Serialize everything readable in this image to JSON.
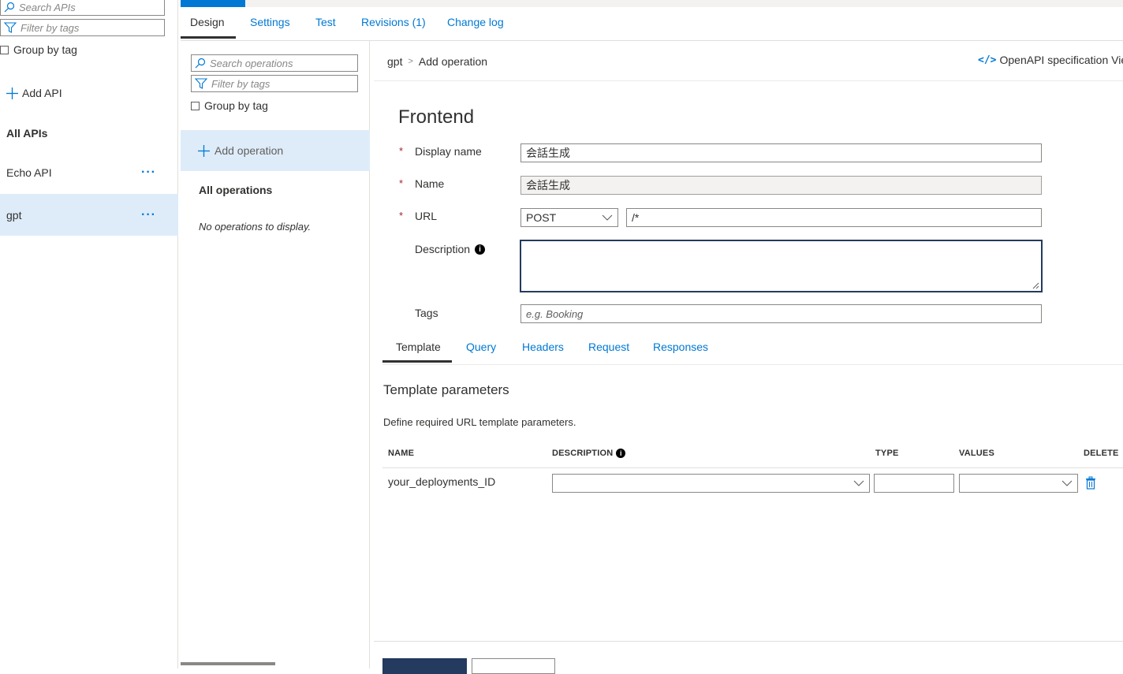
{
  "api_panel": {
    "search_placeholder": "Search APIs",
    "filter_placeholder": "Filter by tags",
    "group_by_tag": "Group by tag",
    "add_api": "Add API",
    "all_apis": "All APIs",
    "apis": [
      {
        "label": "Echo API"
      },
      {
        "label": "gpt"
      }
    ]
  },
  "top_tabs": [
    {
      "label": "Design"
    },
    {
      "label": "Settings"
    },
    {
      "label": "Test"
    },
    {
      "label": "Revisions (1)"
    },
    {
      "label": "Change log"
    }
  ],
  "ops_panel": {
    "search_placeholder": "Search operations",
    "filter_placeholder": "Filter by tags",
    "group_by_tag": "Group by tag",
    "add_operation": "Add operation",
    "all_operations": "All operations",
    "empty": "No operations to display."
  },
  "breadcrumb": {
    "root": "gpt",
    "separator": ">",
    "current": "Add operation"
  },
  "openapi_link": "OpenAPI specification View",
  "frontend": {
    "title": "Frontend",
    "required_mark": "*",
    "display_name_label": "Display name",
    "display_name_value": "会話生成",
    "name_label": "Name",
    "name_value": "会話生成",
    "url_label": "URL",
    "method": "POST",
    "url_value": "/*",
    "description_label": "Description",
    "tags_label": "Tags",
    "tags_placeholder": "e.g. Booking"
  },
  "sub_tabs": [
    {
      "label": "Template"
    },
    {
      "label": "Query"
    },
    {
      "label": "Headers"
    },
    {
      "label": "Request"
    },
    {
      "label": "Responses"
    }
  ],
  "template": {
    "title": "Template parameters",
    "description": "Define required URL template parameters.",
    "columns": {
      "name": "NAME",
      "description": "DESCRIPTION",
      "type": "TYPE",
      "values": "VALUES",
      "delete": "DELETE"
    },
    "rows": [
      {
        "name": "your_deployments_ID"
      }
    ]
  },
  "colors": {
    "accent": "#0078d4",
    "selected_bg": "#deecf9",
    "required": "#a4262c",
    "primary_button": "#243a5e"
  }
}
